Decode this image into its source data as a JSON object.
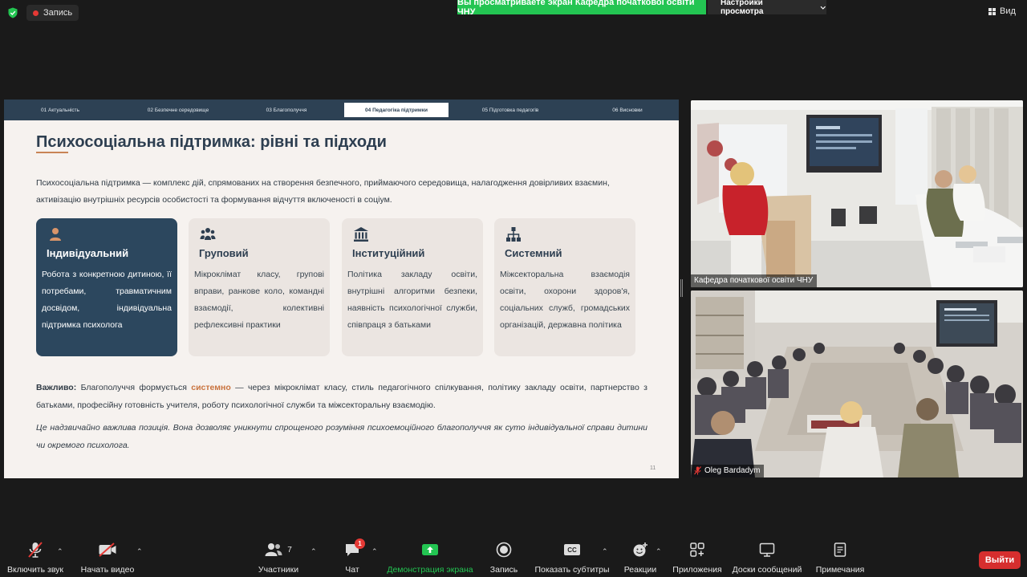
{
  "top": {
    "record_label": "Запись",
    "share_banner": "Вы просматриваете экран Кафедра початкової освіти ЧНУ",
    "view_settings": "Настройки просмотра",
    "view_label": "Вид"
  },
  "slide": {
    "tabs": [
      {
        "label": "01 Актуальність"
      },
      {
        "label": "02 Безпечне середовище"
      },
      {
        "label": "03 Благополуччя"
      },
      {
        "label": "04 Педагогіка підтримки"
      },
      {
        "label": "05 Підготовка педагогів"
      },
      {
        "label": "06 Висновки"
      }
    ],
    "active_tab": 3,
    "title": "Психосоціальна підтримка: рівні та підходи",
    "intro": "Психосоціальна підтримка — комплекс дій, спрямованих на створення безпечного, приймаючого середовища, налагодження довірливих взаємин, активізацію внутрішніх ресурсів особистості та формування відчуття включеності в соціум.",
    "cards": [
      {
        "icon": "person-icon",
        "title": "Індивідуальний",
        "text": "Робота з конкретною дитиною, її потребами, травматичним досвідом, індивідуальна підтримка психолога"
      },
      {
        "icon": "group-icon",
        "title": "Груповий",
        "text": "Мікроклімат класу, групові вправи, ранкове коло, командні взаємодії, колективні рефлексивні практики"
      },
      {
        "icon": "institution-icon",
        "title": "Інституційний",
        "text": "Політика закладу освіти, внутрішні алгоритми безпеки, наявність психологічної служби, співпраця з батьками"
      },
      {
        "icon": "hierarchy-icon",
        "title": "Системний",
        "text": "Міжсекторальна взаємодія освіти, охорони здоров'я, соціальних служб, громадських організацій, державна політика"
      }
    ],
    "important_label": "Важливо:",
    "important_pre": " Благополуччя формується ",
    "important_highlight": "системно",
    "important_post": " — через мікроклімат класу, стиль педагогічного спілкування, політику закладу освіти, партнерство з батьками, професійну готовність учителя, роботу психологічної служби та міжсекторальну взаємодію.",
    "note": "Це надзвичайно важлива позиція. Вона дозволяє уникнути спрощеного розуміння психоемоційного благополуччя як суто індивідуальної справи дитини чи окремого психолога.",
    "page_number": "11"
  },
  "videos": [
    {
      "name": "Кафедра початкової освіти ЧНУ",
      "muted": false
    },
    {
      "name": "Oleg Bardadym",
      "muted": true
    }
  ],
  "toolbar": {
    "audio": "Включить звук",
    "video": "Начать видео",
    "participants": "Участники",
    "participants_count": "7",
    "chat": "Чат",
    "chat_badge": "1",
    "share": "Демонстрация экрана",
    "record": "Запись",
    "captions": "Показать субтитры",
    "captions_icon_text": "CC",
    "reactions": "Реакции",
    "apps": "Приложения",
    "whiteboards": "Доски сообщений",
    "notes": "Примечания",
    "leave": "Выйти"
  },
  "colors": {
    "share_green": "#23c552",
    "slide_nav": "#2d4154",
    "accent_orange": "#c9733e",
    "leave_red": "#d62e2e"
  }
}
